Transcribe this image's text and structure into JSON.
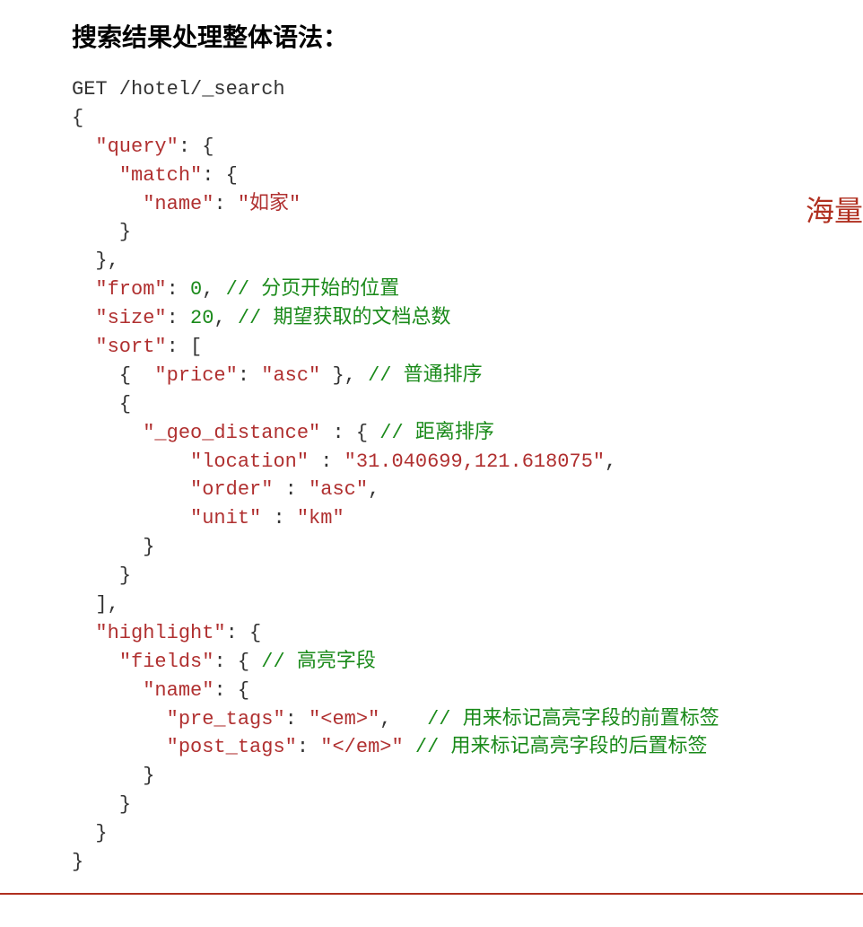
{
  "heading": "搜索结果处理整体语法：",
  "watermark_fragment": "海量",
  "code": {
    "request_line": "GET /hotel/_search",
    "open1": "{",
    "l_query_key": "\"query\"",
    "l_match_key": "\"match\"",
    "l_name_key": "\"name\"",
    "l_name_val": "\"如家\"",
    "l_from_key": "\"from\"",
    "l_from_val": "0",
    "c_from": "// 分页开始的位置",
    "l_size_key": "\"size\"",
    "l_size_val": "20",
    "c_size": "// 期望获取的文档总数",
    "l_sort_key": "\"sort\"",
    "l_price_key": "\"price\"",
    "l_price_val": "\"asc\"",
    "c_price": "// 普通排序",
    "l_geo_key": "\"_geo_distance\"",
    "c_geo": "// 距离排序",
    "l_location_key": "\"location\"",
    "l_location_val": "\"31.040699,121.618075\"",
    "l_order_key": "\"order\"",
    "l_order_val": "\"asc\"",
    "l_unit_key": "\"unit\"",
    "l_unit_val": "\"km\"",
    "l_highlight_key": "\"highlight\"",
    "l_fields_key": "\"fields\"",
    "c_fields": "// 高亮字段",
    "l_hname_key": "\"name\"",
    "l_pre_key": "\"pre_tags\"",
    "l_pre_val": "\"<em>\"",
    "c_pre": "// 用来标记高亮字段的前置标签",
    "l_post_key": "\"post_tags\"",
    "l_post_val": "\"</em>\"",
    "c_post": "// 用来标记高亮字段的后置标签"
  }
}
